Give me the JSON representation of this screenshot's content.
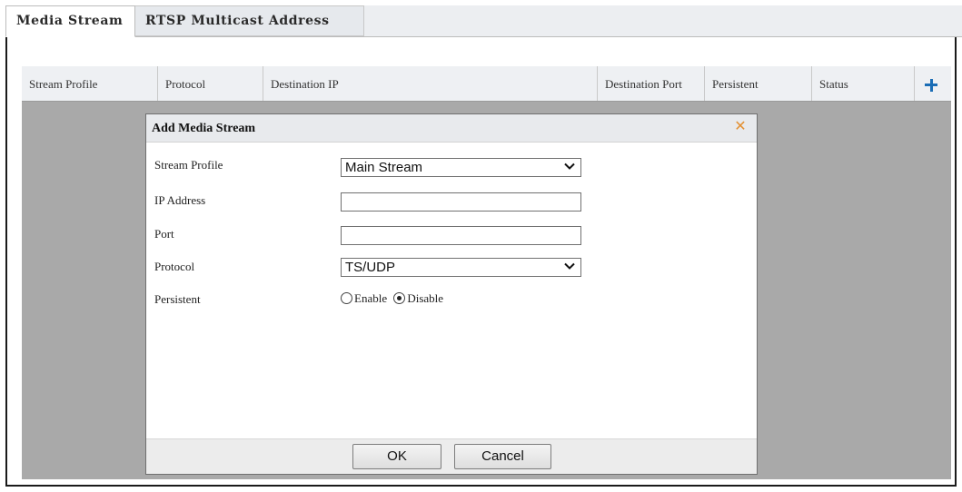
{
  "tabs": [
    {
      "label": "Media Stream",
      "active": true
    },
    {
      "label": "RTSP Multicast Address",
      "active": false
    }
  ],
  "table": {
    "columns": [
      "Stream Profile",
      "Protocol",
      "Destination IP",
      "Destination Port",
      "Persistent",
      "Status"
    ],
    "add_icon": "plus-icon"
  },
  "dialog": {
    "title": "Add Media Stream",
    "close_icon": "close-icon",
    "fields": {
      "stream_profile": {
        "label": "Stream Profile",
        "value": "Main Stream"
      },
      "ip_address": {
        "label": "IP Address",
        "value": ""
      },
      "port": {
        "label": "Port",
        "value": ""
      },
      "protocol": {
        "label": "Protocol",
        "value": "TS/UDP"
      },
      "persistent": {
        "label": "Persistent",
        "options": [
          "Enable",
          "Disable"
        ],
        "selected": "Disable"
      }
    },
    "buttons": {
      "ok": "OK",
      "cancel": "Cancel"
    }
  },
  "colors": {
    "accent_blue": "#1a6db5",
    "close_orange": "#e39134",
    "overlay_grey": "#a9a9a9"
  }
}
